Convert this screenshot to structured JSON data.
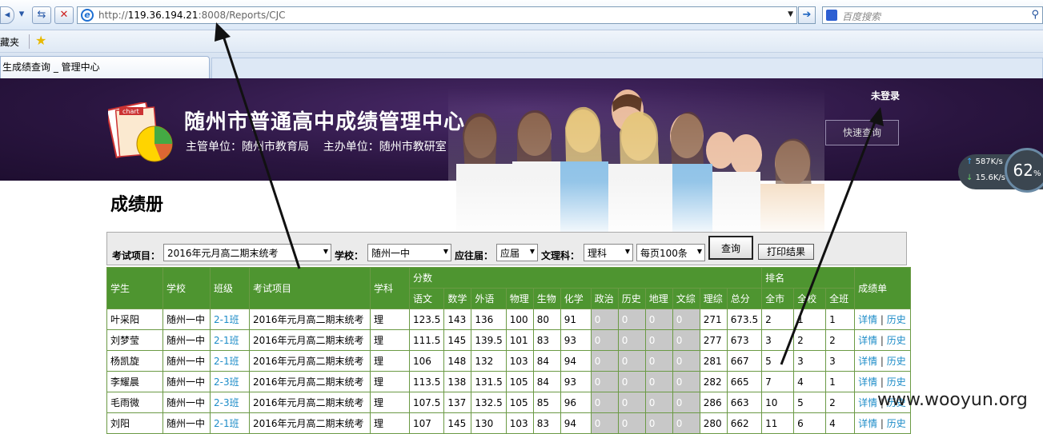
{
  "browser": {
    "url_prefix": "http://",
    "url_host": "119.36.194.21",
    "url_rest": ":8008/Reports/CJC",
    "search_placeholder": "百度搜索",
    "favorites_label": "藏夹",
    "tab_title": "生成绩查询 _ 管理中心"
  },
  "header": {
    "title": "随州市普通高中成绩管理中心",
    "subtitle": "主管单位：随州市教育局    主办单位：随州市教研室",
    "login_status": "未登录",
    "quick_button": "快速查询",
    "logo_text": "chart"
  },
  "speed_widget": {
    "up": "587",
    "down": "15.6",
    "unit": "K/s",
    "percent": "62",
    "percent_sign": "%"
  },
  "page": {
    "title": "成绩册"
  },
  "filters": {
    "exam_label": "考试项目：",
    "exam_value": "2016年元月高二期末统考",
    "school_label": "学校：",
    "school_value": "随州一中",
    "grad_label": "应往届：",
    "grad_value": "应届",
    "track_label": "文理科：",
    "track_value": "理科",
    "page_size_value": "每页100条",
    "query_button": "查询",
    "print_button": "打印结果"
  },
  "table": {
    "headers": {
      "student": "学生",
      "school": "学校",
      "class": "班级",
      "exam": "考试项目",
      "subject": "学科",
      "scores": "分数",
      "rank": "排名",
      "report": "成绩单",
      "score_cols": [
        "语文",
        "数学",
        "外语",
        "物理",
        "生物",
        "化学",
        "政治",
        "历史",
        "地理",
        "文综",
        "理综",
        "总分"
      ],
      "rank_cols": [
        "全市",
        "全校",
        "全班"
      ]
    },
    "detail_link": "详情",
    "history_link": "历史",
    "rows": [
      {
        "name": "叶采阳",
        "school": "随州一中",
        "class": "2-1班",
        "exam": "2016年元月高二期末统考",
        "subj": "理",
        "scores": [
          "123.5",
          "143",
          "136",
          "100",
          "80",
          "91",
          "0",
          "0",
          "0",
          "0",
          "271",
          "673.5"
        ],
        "ranks": [
          "2",
          "1",
          "1"
        ]
      },
      {
        "name": "刘梦莹",
        "school": "随州一中",
        "class": "2-1班",
        "exam": "2016年元月高二期末统考",
        "subj": "理",
        "scores": [
          "111.5",
          "145",
          "139.5",
          "101",
          "83",
          "93",
          "0",
          "0",
          "0",
          "0",
          "277",
          "673"
        ],
        "ranks": [
          "3",
          "2",
          "2"
        ]
      },
      {
        "name": "杨凯旋",
        "school": "随州一中",
        "class": "2-1班",
        "exam": "2016年元月高二期末统考",
        "subj": "理",
        "scores": [
          "106",
          "148",
          "132",
          "103",
          "84",
          "94",
          "0",
          "0",
          "0",
          "0",
          "281",
          "667"
        ],
        "ranks": [
          "5",
          "3",
          "3"
        ]
      },
      {
        "name": "李耀晨",
        "school": "随州一中",
        "class": "2-3班",
        "exam": "2016年元月高二期末统考",
        "subj": "理",
        "scores": [
          "113.5",
          "138",
          "131.5",
          "105",
          "84",
          "93",
          "0",
          "0",
          "0",
          "0",
          "282",
          "665"
        ],
        "ranks": [
          "7",
          "4",
          "1"
        ]
      },
      {
        "name": "毛雨微",
        "school": "随州一中",
        "class": "2-3班",
        "exam": "2016年元月高二期末统考",
        "subj": "理",
        "scores": [
          "107.5",
          "137",
          "132.5",
          "105",
          "85",
          "96",
          "0",
          "0",
          "0",
          "0",
          "286",
          "663"
        ],
        "ranks": [
          "10",
          "5",
          "2"
        ]
      },
      {
        "name": "刘阳",
        "school": "随州一中",
        "class": "2-1班",
        "exam": "2016年元月高二期末统考",
        "subj": "理",
        "scores": [
          "107",
          "145",
          "130",
          "103",
          "83",
          "94",
          "0",
          "0",
          "0",
          "0",
          "280",
          "662"
        ],
        "ranks": [
          "11",
          "6",
          "4"
        ]
      }
    ]
  },
  "watermark": "www.wooyun.org"
}
